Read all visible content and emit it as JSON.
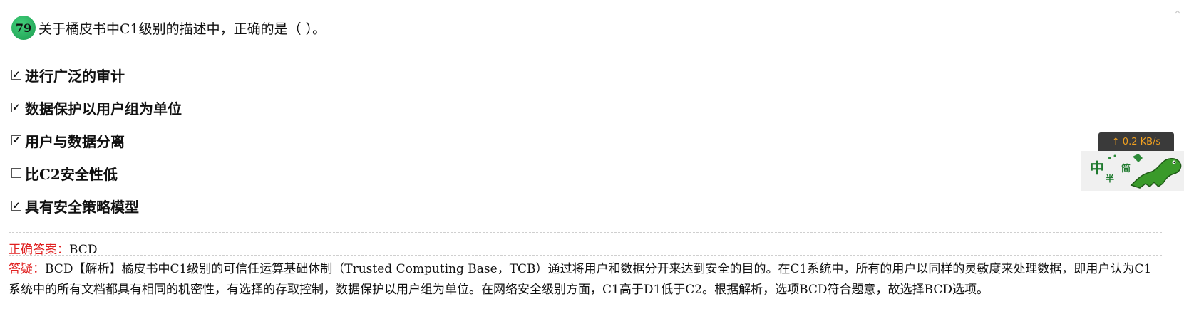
{
  "question": {
    "number": "79",
    "text": "关于橘皮书中C1级别的描述中，正确的是（ ）。"
  },
  "options": [
    {
      "checked": true,
      "label": "进行广泛的审计"
    },
    {
      "checked": true,
      "label": "数据保护以用户组为单位"
    },
    {
      "checked": true,
      "label": "用户与数据分离"
    },
    {
      "checked": false,
      "label": "比C2安全性低"
    },
    {
      "checked": true,
      "label": "具有安全策略模型"
    }
  ],
  "answer": {
    "label": "正确答案：",
    "value": "BCD"
  },
  "explanation": {
    "label": "答疑：",
    "text": "BCD【解析】橘皮书中C1级别的可信任运算基础体制（Trusted Computing Base，TCB）通过将用户和数据分开来达到安全的目的。在C1系统中，所有的用户以同样的灵敏度来处理数据，即用户认为C1系统中的所有文档都具有相同的机密性，有选择的存取控制，数据保护以用户组为单位。在网络安全级别方面，C1高于D1低于C2。根据解析，选项BCD符合题意，故选择BCD选项。"
  },
  "widget": {
    "speed": "↑ 0.2 KB/s",
    "mascot_chars": [
      "中",
      "半",
      "简"
    ]
  },
  "colors": {
    "accent_red": "#e02020",
    "badge_green": "#27ab5c",
    "speed_text": "#f0a020"
  },
  "icons": {
    "scroll_up": "chevron-up-icon"
  }
}
